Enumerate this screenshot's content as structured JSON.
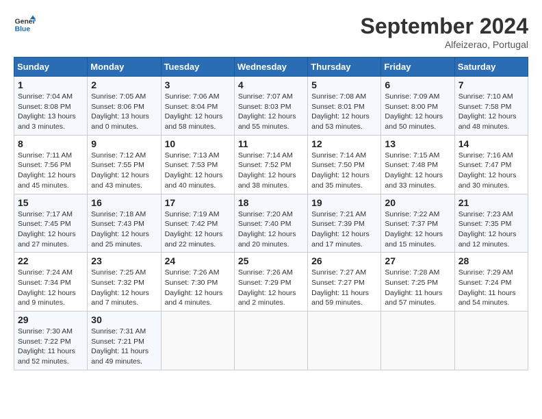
{
  "header": {
    "logo_line1": "General",
    "logo_line2": "Blue",
    "month": "September 2024",
    "location": "Alfeizerao, Portugal"
  },
  "weekdays": [
    "Sunday",
    "Monday",
    "Tuesday",
    "Wednesday",
    "Thursday",
    "Friday",
    "Saturday"
  ],
  "weeks": [
    [
      {
        "day": "1",
        "info": "Sunrise: 7:04 AM\nSunset: 8:08 PM\nDaylight: 13 hours\nand 3 minutes."
      },
      {
        "day": "2",
        "info": "Sunrise: 7:05 AM\nSunset: 8:06 PM\nDaylight: 13 hours\nand 0 minutes."
      },
      {
        "day": "3",
        "info": "Sunrise: 7:06 AM\nSunset: 8:04 PM\nDaylight: 12 hours\nand 58 minutes."
      },
      {
        "day": "4",
        "info": "Sunrise: 7:07 AM\nSunset: 8:03 PM\nDaylight: 12 hours\nand 55 minutes."
      },
      {
        "day": "5",
        "info": "Sunrise: 7:08 AM\nSunset: 8:01 PM\nDaylight: 12 hours\nand 53 minutes."
      },
      {
        "day": "6",
        "info": "Sunrise: 7:09 AM\nSunset: 8:00 PM\nDaylight: 12 hours\nand 50 minutes."
      },
      {
        "day": "7",
        "info": "Sunrise: 7:10 AM\nSunset: 7:58 PM\nDaylight: 12 hours\nand 48 minutes."
      }
    ],
    [
      {
        "day": "8",
        "info": "Sunrise: 7:11 AM\nSunset: 7:56 PM\nDaylight: 12 hours\nand 45 minutes."
      },
      {
        "day": "9",
        "info": "Sunrise: 7:12 AM\nSunset: 7:55 PM\nDaylight: 12 hours\nand 43 minutes."
      },
      {
        "day": "10",
        "info": "Sunrise: 7:13 AM\nSunset: 7:53 PM\nDaylight: 12 hours\nand 40 minutes."
      },
      {
        "day": "11",
        "info": "Sunrise: 7:14 AM\nSunset: 7:52 PM\nDaylight: 12 hours\nand 38 minutes."
      },
      {
        "day": "12",
        "info": "Sunrise: 7:14 AM\nSunset: 7:50 PM\nDaylight: 12 hours\nand 35 minutes."
      },
      {
        "day": "13",
        "info": "Sunrise: 7:15 AM\nSunset: 7:48 PM\nDaylight: 12 hours\nand 33 minutes."
      },
      {
        "day": "14",
        "info": "Sunrise: 7:16 AM\nSunset: 7:47 PM\nDaylight: 12 hours\nand 30 minutes."
      }
    ],
    [
      {
        "day": "15",
        "info": "Sunrise: 7:17 AM\nSunset: 7:45 PM\nDaylight: 12 hours\nand 27 minutes."
      },
      {
        "day": "16",
        "info": "Sunrise: 7:18 AM\nSunset: 7:43 PM\nDaylight: 12 hours\nand 25 minutes."
      },
      {
        "day": "17",
        "info": "Sunrise: 7:19 AM\nSunset: 7:42 PM\nDaylight: 12 hours\nand 22 minutes."
      },
      {
        "day": "18",
        "info": "Sunrise: 7:20 AM\nSunset: 7:40 PM\nDaylight: 12 hours\nand 20 minutes."
      },
      {
        "day": "19",
        "info": "Sunrise: 7:21 AM\nSunset: 7:39 PM\nDaylight: 12 hours\nand 17 minutes."
      },
      {
        "day": "20",
        "info": "Sunrise: 7:22 AM\nSunset: 7:37 PM\nDaylight: 12 hours\nand 15 minutes."
      },
      {
        "day": "21",
        "info": "Sunrise: 7:23 AM\nSunset: 7:35 PM\nDaylight: 12 hours\nand 12 minutes."
      }
    ],
    [
      {
        "day": "22",
        "info": "Sunrise: 7:24 AM\nSunset: 7:34 PM\nDaylight: 12 hours\nand 9 minutes."
      },
      {
        "day": "23",
        "info": "Sunrise: 7:25 AM\nSunset: 7:32 PM\nDaylight: 12 hours\nand 7 minutes."
      },
      {
        "day": "24",
        "info": "Sunrise: 7:26 AM\nSunset: 7:30 PM\nDaylight: 12 hours\nand 4 minutes."
      },
      {
        "day": "25",
        "info": "Sunrise: 7:26 AM\nSunset: 7:29 PM\nDaylight: 12 hours\nand 2 minutes."
      },
      {
        "day": "26",
        "info": "Sunrise: 7:27 AM\nSunset: 7:27 PM\nDaylight: 11 hours\nand 59 minutes."
      },
      {
        "day": "27",
        "info": "Sunrise: 7:28 AM\nSunset: 7:25 PM\nDaylight: 11 hours\nand 57 minutes."
      },
      {
        "day": "28",
        "info": "Sunrise: 7:29 AM\nSunset: 7:24 PM\nDaylight: 11 hours\nand 54 minutes."
      }
    ],
    [
      {
        "day": "29",
        "info": "Sunrise: 7:30 AM\nSunset: 7:22 PM\nDaylight: 11 hours\nand 52 minutes."
      },
      {
        "day": "30",
        "info": "Sunrise: 7:31 AM\nSunset: 7:21 PM\nDaylight: 11 hours\nand 49 minutes."
      },
      {
        "day": "",
        "info": ""
      },
      {
        "day": "",
        "info": ""
      },
      {
        "day": "",
        "info": ""
      },
      {
        "day": "",
        "info": ""
      },
      {
        "day": "",
        "info": ""
      }
    ]
  ]
}
